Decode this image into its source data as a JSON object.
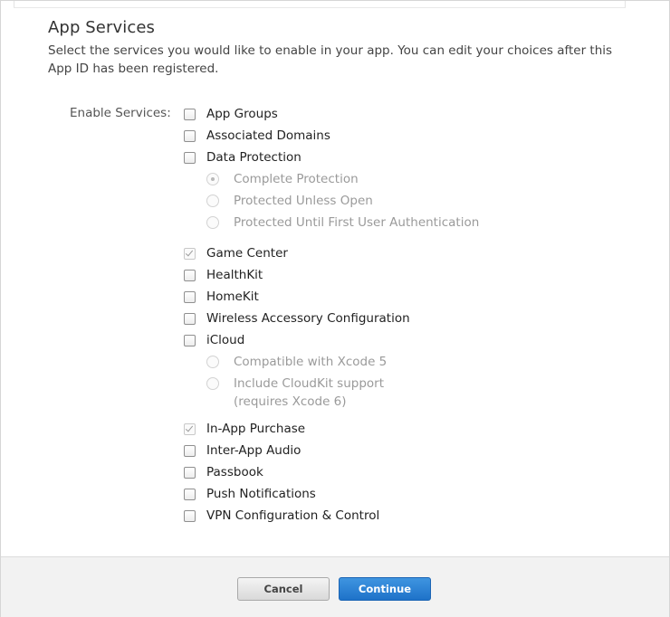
{
  "section": {
    "title": "App Services",
    "description": "Select the services you would like to enable in your app. You can edit your choices after this App ID has been registered.",
    "enable_label": "Enable Services:"
  },
  "services": [
    {
      "label": "App Groups",
      "checked": false,
      "disabled": false
    },
    {
      "label": "Associated Domains",
      "checked": false,
      "disabled": false
    },
    {
      "label": "Data Protection",
      "checked": false,
      "disabled": false
    },
    {
      "label": "Game Center",
      "checked": true,
      "disabled": true
    },
    {
      "label": "HealthKit",
      "checked": false,
      "disabled": false
    },
    {
      "label": "HomeKit",
      "checked": false,
      "disabled": false
    },
    {
      "label": "Wireless Accessory Configuration",
      "checked": false,
      "disabled": false
    },
    {
      "label": "iCloud",
      "checked": false,
      "disabled": false
    },
    {
      "label": "In-App Purchase",
      "checked": true,
      "disabled": true
    },
    {
      "label": "Inter-App Audio",
      "checked": false,
      "disabled": false
    },
    {
      "label": "Passbook",
      "checked": false,
      "disabled": false
    },
    {
      "label": "Push Notifications",
      "checked": false,
      "disabled": false
    },
    {
      "label": "VPN Configuration & Control",
      "checked": false,
      "disabled": false
    }
  ],
  "data_protection_options": [
    {
      "label": "Complete Protection",
      "selected": true
    },
    {
      "label": "Protected Unless Open",
      "selected": false
    },
    {
      "label": "Protected Until First User Authentication",
      "selected": false
    }
  ],
  "icloud_options": [
    {
      "label": "Compatible with Xcode 5",
      "sublabel": "",
      "selected": false
    },
    {
      "label": "Include CloudKit support",
      "sublabel": "(requires Xcode 6)",
      "selected": false
    }
  ],
  "footer": {
    "cancel_label": "Cancel",
    "continue_label": "Continue"
  }
}
